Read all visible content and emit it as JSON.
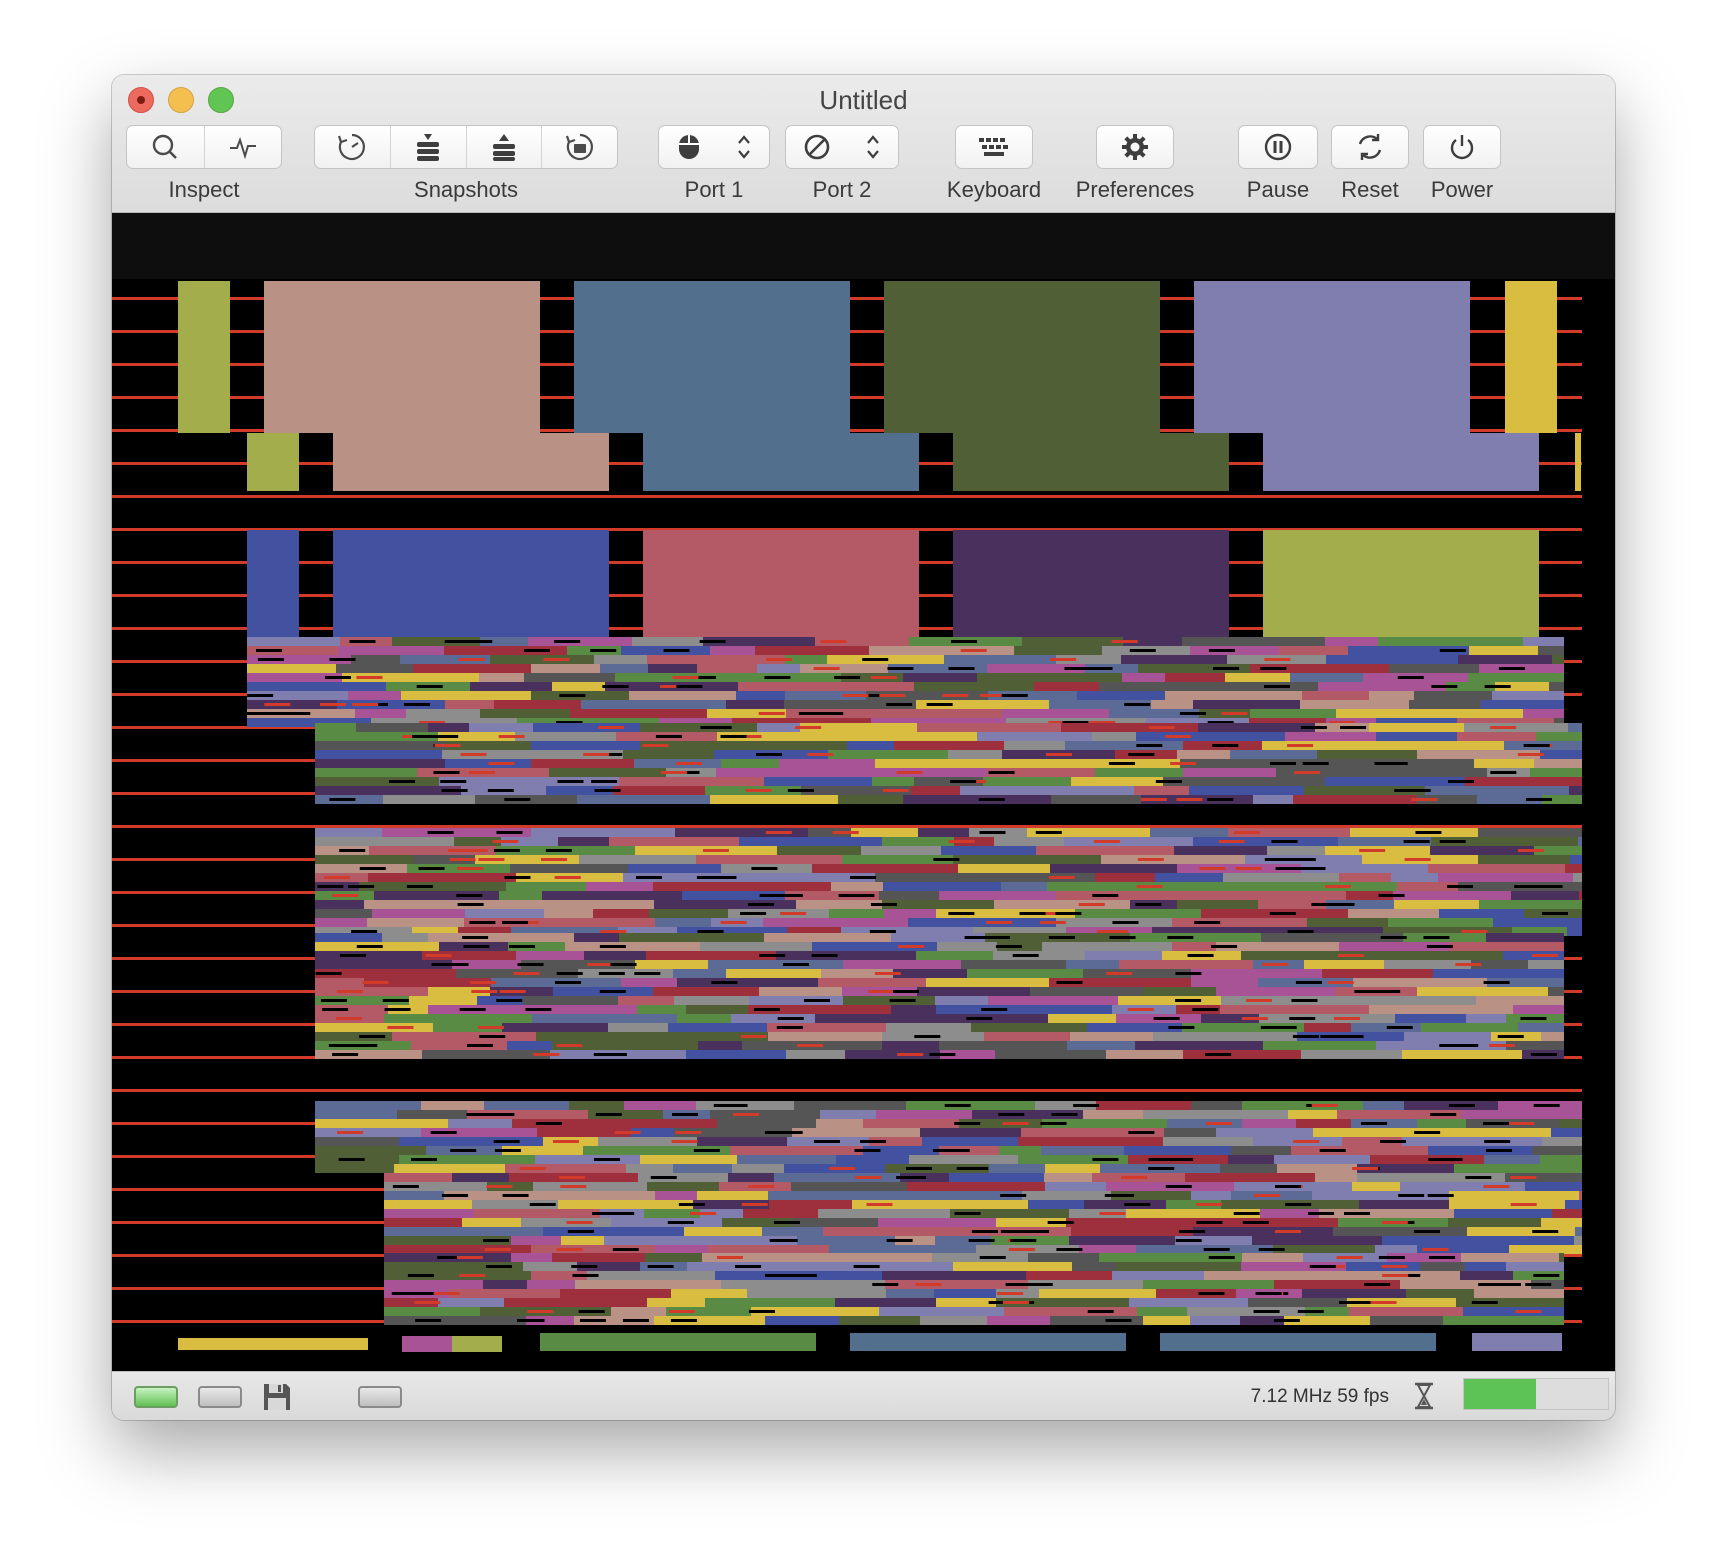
{
  "window": {
    "title": "Untitled"
  },
  "toolbar": {
    "inspect": {
      "label": "Inspect",
      "buttons": [
        "magnifier-icon",
        "activity-icon"
      ]
    },
    "snapshots": {
      "label": "Snapshots",
      "buttons": [
        "snapshot-take-icon",
        "snapshot-stack-icon",
        "snapshot-eject-icon",
        "snapshot-restore-icon"
      ]
    },
    "port1": {
      "label": "Port 1",
      "icon": "mouse-icon"
    },
    "port2": {
      "label": "Port 2",
      "icon": "none-icon"
    },
    "keyboard": {
      "label": "Keyboard",
      "icon": "keyboard-icon"
    },
    "preferences": {
      "label": "Preferences",
      "icon": "gear-icon"
    },
    "pause": {
      "label": "Pause",
      "icon": "pause-icon"
    },
    "reset": {
      "label": "Reset",
      "icon": "reset-icon"
    },
    "power": {
      "label": "Power",
      "icon": "power-icon"
    }
  },
  "status": {
    "speed": "7.12 MHz 59 fps",
    "meter_fraction": 0.5
  },
  "colors": {
    "accent_green": "#5ec357",
    "raster_red": "#d23a2a"
  }
}
